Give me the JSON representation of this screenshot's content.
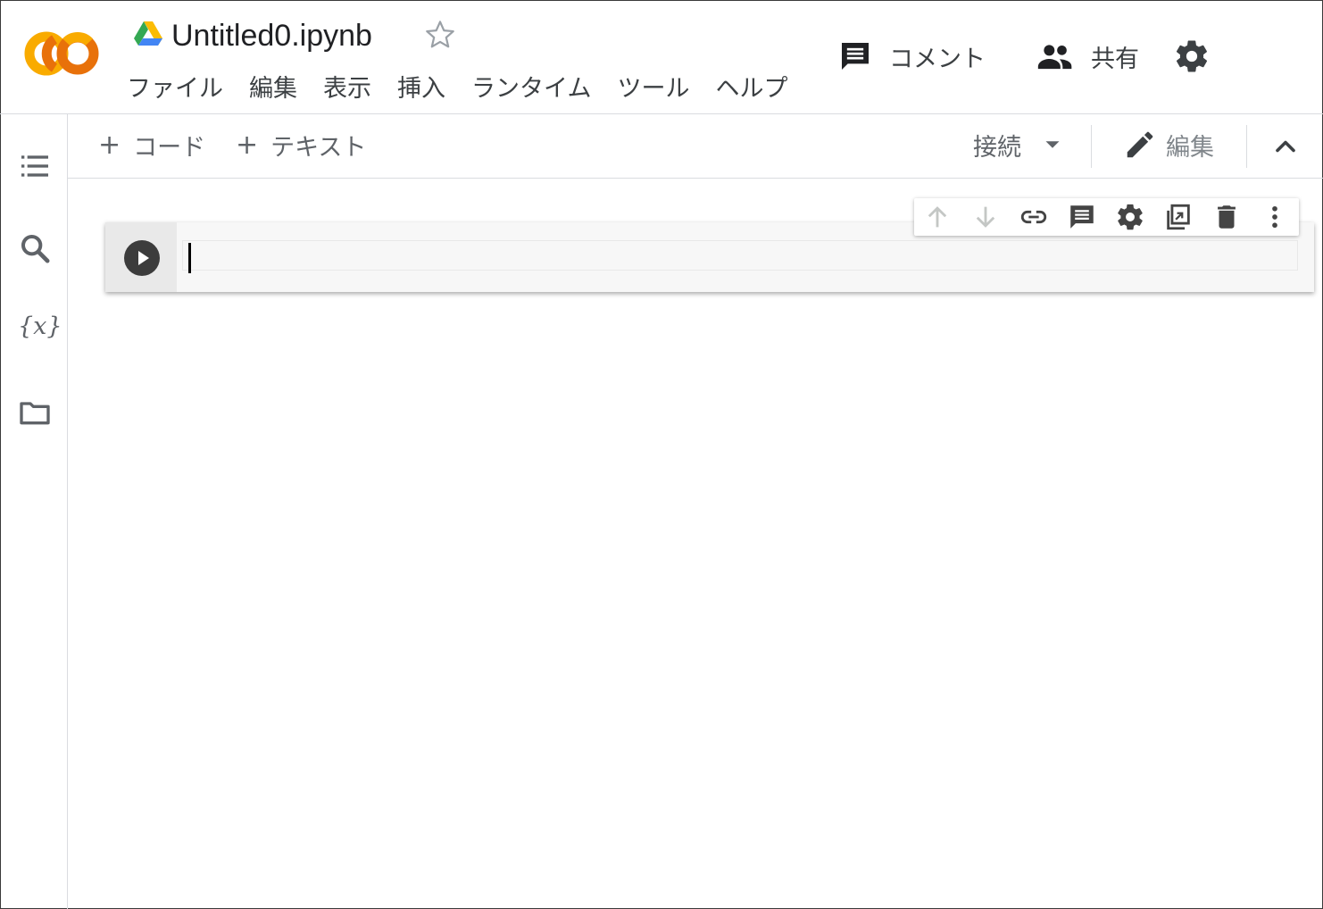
{
  "app": {
    "logo_text": "CO",
    "title": "Untitled0.ipynb"
  },
  "menu": [
    "ファイル",
    "編集",
    "表示",
    "挿入",
    "ランタイム",
    "ツール",
    "ヘルプ"
  ],
  "header_actions": {
    "comment_label": "コメント",
    "share_label": "共有"
  },
  "toolbar": {
    "add_code_label": "コード",
    "add_text_label": "テキスト",
    "connect_label": "接続",
    "edit_label": "編集"
  },
  "sidebar": {
    "variables_label": "{x}"
  },
  "cell": {
    "code": ""
  },
  "colors": {
    "logo_orange": "#e8710a",
    "logo_yellow": "#f9ab00",
    "icon_gray": "#5f6368",
    "icon_dark": "#444444"
  }
}
